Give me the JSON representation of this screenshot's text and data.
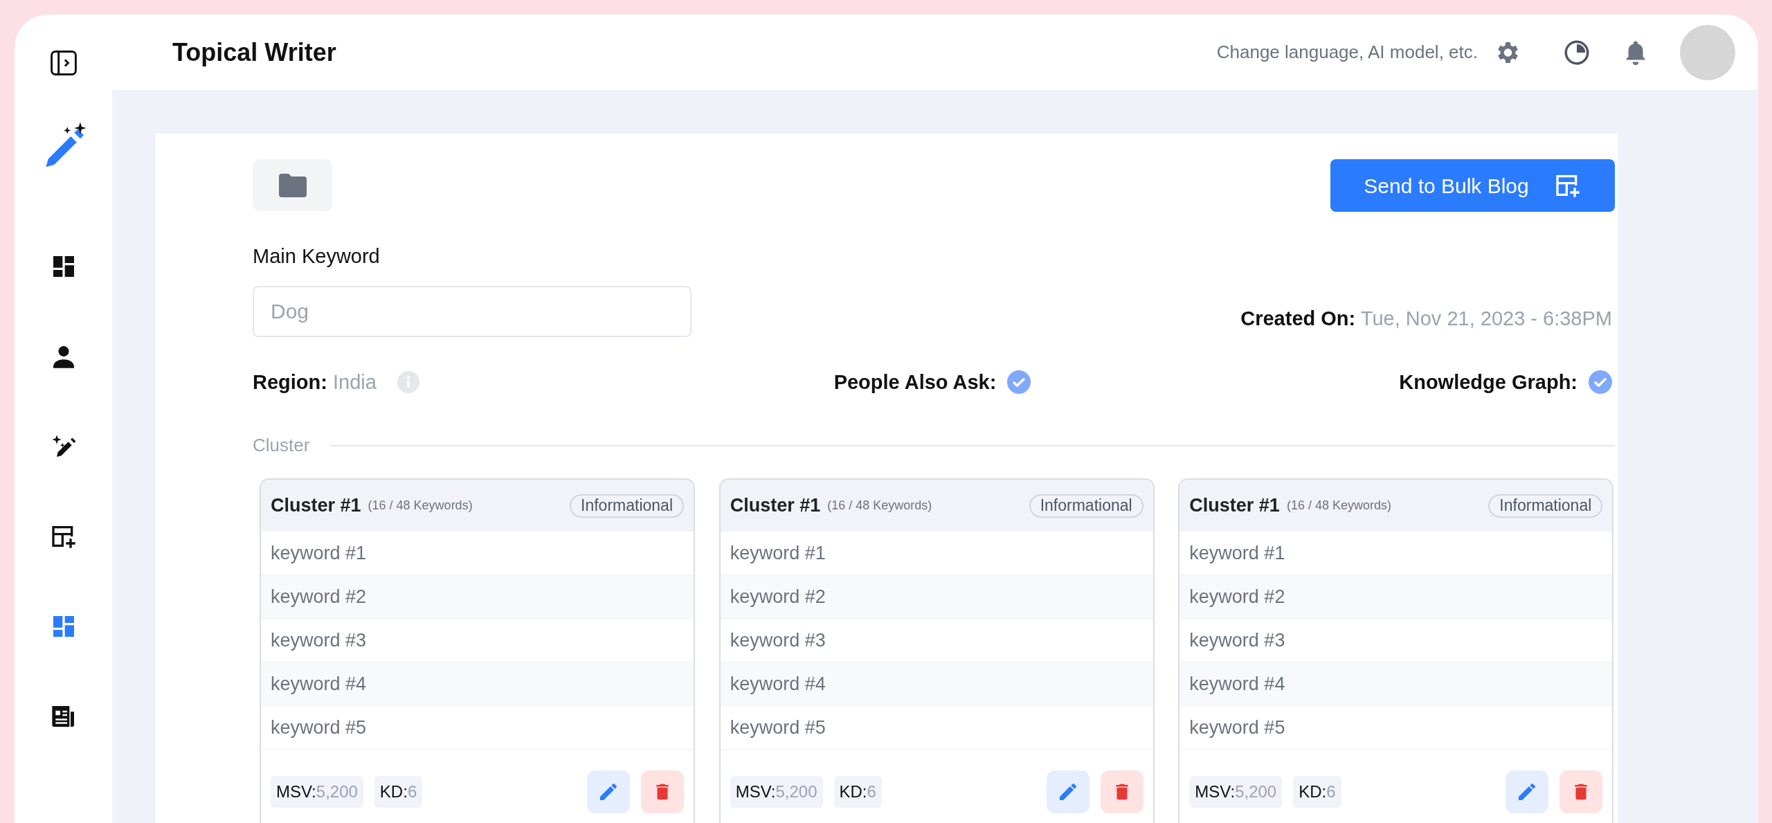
{
  "header": {
    "title": "Topical Writer",
    "settings_hint": "Change language, AI model, etc."
  },
  "sidebar": {
    "items": [
      {
        "kind": "dashboard",
        "selected": false
      },
      {
        "kind": "person",
        "selected": false
      },
      {
        "kind": "magic-pen",
        "selected": false
      },
      {
        "kind": "calendar-add",
        "selected": false
      },
      {
        "kind": "dashboard",
        "selected": true
      },
      {
        "kind": "news",
        "selected": false
      }
    ]
  },
  "toolbar": {
    "send_button": "Send to Bulk Blog"
  },
  "form": {
    "main_keyword_label": "Main Keyword",
    "main_keyword_placeholder": "Dog",
    "created_on_label": "Created On:",
    "created_on_value": "Tue, Nov 21, 2023 - 6:38PM",
    "region_label": "Region:",
    "region_value": "India",
    "people_also_ask": {
      "label": "People Also Ask:",
      "checked": true
    },
    "knowledge_graph": {
      "label": "Knowledge Graph:",
      "checked": true
    }
  },
  "cluster_section": {
    "label": "Cluster",
    "clusters": [
      {
        "title": "Cluster #1",
        "count": "(16 / 48 Keywords)",
        "tag": "Informational",
        "keywords": [
          "keyword #1",
          "keyword #2",
          "keyword #3",
          "keyword #4",
          "keyword #5"
        ],
        "msv_label": "MSV:",
        "msv": "5,200",
        "kd_label": "KD:",
        "kd": "6"
      },
      {
        "title": "Cluster #1",
        "count": "(16 / 48 Keywords)",
        "tag": "Informational",
        "keywords": [
          "keyword #1",
          "keyword #2",
          "keyword #3",
          "keyword #4",
          "keyword #5"
        ],
        "msv_label": "MSV:",
        "msv": "5,200",
        "kd_label": "KD:",
        "kd": "6"
      },
      {
        "title": "Cluster #1",
        "count": "(16 / 48 Keywords)",
        "tag": "Informational",
        "keywords": [
          "keyword #1",
          "keyword #2",
          "keyword #3",
          "keyword #4",
          "keyword #5"
        ],
        "msv_label": "MSV:",
        "msv": "5,200",
        "kd_label": "KD:",
        "kd": "6"
      }
    ]
  }
}
